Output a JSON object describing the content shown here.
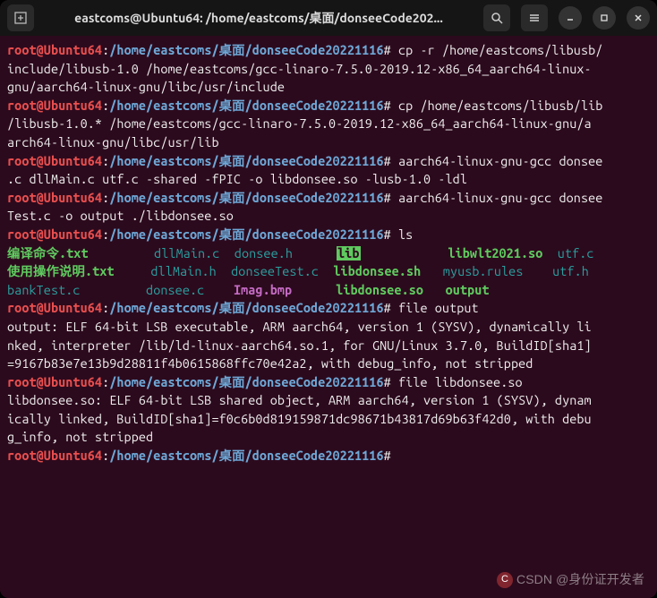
{
  "titlebar": {
    "title": "eastcoms@Ubuntu64: /home/eastcoms/桌面/donseeCode202...",
    "newtab_icon": "[+]"
  },
  "prompt": {
    "user": "root@Ubuntu64",
    "colon": ":",
    "path": "/home/eastcoms/桌面/donseeCode20221116",
    "hash": "#"
  },
  "commands": {
    "cp_include": "cp -r /home/eastcoms/libusb/include/libusb-1.0 /home/eastcoms/gcc-linaro-7.5.0-2019.12-x86_64_aarch64-linux-gnu/aarch64-linux-gnu/libc/usr/include",
    "cp_lib": "cp /home/eastcoms/libusb/lib/libusb-1.0.* /home/eastcoms/gcc-linaro-7.5.0-2019.12-x86_64_aarch64-linux-gnu/aarch64-linux-gnu/libc/usr/lib",
    "gcc_shared": "aarch64-linux-gnu-gcc donsee.c dllMain.c utf.c -shared -fPIC -o libdonsee.so -lusb-1.0 -ldl",
    "gcc_test": "aarch64-linux-gnu-gcc donseeTest.c -o output ./libdonsee.so",
    "ls": "ls",
    "file_output": "file output",
    "file_lib": "file libdonsee.so"
  },
  "ls_rows": [
    [
      {
        "text": "编译命令.txt",
        "cls": "ls-exec",
        "pad": 17
      },
      {
        "text": "dllMain.c",
        "cls": "ls-file",
        "pad": 11
      },
      {
        "text": "donsee.h",
        "cls": "ls-file",
        "pad": 14
      },
      {
        "text": "lib",
        "cls": "ls-dir",
        "pad": 15
      },
      {
        "text": "libwlt2021.so",
        "cls": "ls-exec",
        "pad": 15
      },
      {
        "text": "utf.c",
        "cls": "ls-file",
        "pad": 0
      }
    ],
    [
      {
        "text": "使用操作说明.txt",
        "cls": "ls-exec",
        "pad": 15
      },
      {
        "text": "dllMain.h",
        "cls": "ls-file",
        "pad": 11
      },
      {
        "text": "donseeTest.c",
        "cls": "ls-file",
        "pad": 14
      },
      {
        "text": "libdonsee.sh",
        "cls": "ls-exec",
        "pad": 15
      },
      {
        "text": "myusb.rules",
        "cls": "ls-file",
        "pad": 15
      },
      {
        "text": "utf.h",
        "cls": "ls-file",
        "pad": 0
      }
    ],
    [
      {
        "text": "bankTest.c",
        "cls": "ls-file",
        "pad": 19
      },
      {
        "text": "donsee.c",
        "cls": "ls-file",
        "pad": 12
      },
      {
        "text": "Imag.bmp",
        "cls": "ls-img",
        "pad": 14
      },
      {
        "text": "libdonsee.so",
        "cls": "ls-exec",
        "pad": 15
      },
      {
        "text": "output",
        "cls": "ls-exec",
        "pad": 0
      }
    ]
  ],
  "outputs": {
    "file_output": "output: ELF 64-bit LSB executable, ARM aarch64, version 1 (SYSV), dynamically linked, interpreter /lib/ld-linux-aarch64.so.1, for GNU/Linux 3.7.0, BuildID[sha1]=9167b83e7e13b9d28811f4b0615868ffc70e42a2, with debug_info, not stripped",
    "file_lib": "libdonsee.so: ELF 64-bit LSB shared object, ARM aarch64, version 1 (SYSV), dynamically linked, BuildID[sha1]=f0c6b0d819159871dc98671b43817d69b63f42d0, with debug_info, not stripped"
  },
  "watermark": {
    "site": "CSDN",
    "author": "@身份证开发者"
  }
}
